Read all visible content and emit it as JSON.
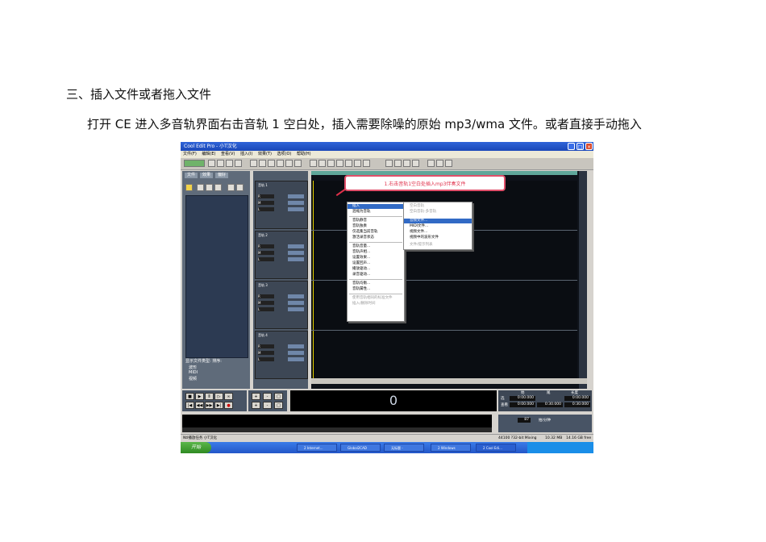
{
  "doc": {
    "heading": "三、插入文件或者拖入文件",
    "paragraph": "打开 CE 进入多音轨界面右击音轨 1 空白处，插入需要除噪的原始 mp3/wma 文件。或者直接手动拖入"
  },
  "screenshot": {
    "window_title": "Cool Edit Pro - 小T汉化",
    "menu": [
      "文件(F)",
      "编辑(E)",
      "查看(V)",
      "插入(I)",
      "效果(T)",
      "选项(O)",
      "帮助(H)"
    ],
    "left_tabs": [
      "文件",
      "效果",
      "偏好"
    ],
    "file_type_label": "显示文件类型:",
    "sort_label": "排序:",
    "file_types": [
      "波形",
      "MIDI",
      "视频"
    ],
    "tracks": [
      "音轨 1",
      "音轨 2",
      "音轨 3",
      "音轨 4"
    ],
    "callout": "1.右击音轨1空白处插入mp3伴奏文件",
    "context_menu": [
      "插入",
      "混缩为音轨",
      "音轨静音",
      "音轨独奏",
      "仅选集当前音轨",
      "激活录音状态",
      "音轨音量...",
      "音轨声相...",
      "设置效果...",
      "设置回声...",
      "播放驱动...",
      "录音驱动...",
      "音轨均衡...",
      "音轨属性...",
      "使用音轨相同的标准文件",
      "插入/删除时间"
    ],
    "submenu": [
      "空白音轨",
      "空白音轨-多音轨",
      "音频文件...",
      "MIDI文件...",
      "视频文件...",
      "视频中的波形文件",
      "文件/提示列表"
    ],
    "time_display": "0",
    "time_header": [
      "始",
      "尾",
      "长度"
    ],
    "time_sel": [
      "0:00.000",
      "0:00.000"
    ],
    "time_view": [
      "0:00.000",
      "0:30.000",
      "0:30.000"
    ],
    "row_labels": [
      "选",
      "查看"
    ],
    "tempo": "87",
    "tempo_unit": "拍/分钟",
    "status_left": "Ntl播放任务 小T汉化",
    "status_rate": "44100 ?32-bit Mixing",
    "status_mem": "10.32 MB",
    "status_disk": "14.16 GB free",
    "start_label": "开始",
    "tasks": [
      "2 Internet...",
      "Global2CAD",
      "无标题 -",
      "2 Windows",
      "2 Cool Edi..."
    ]
  }
}
